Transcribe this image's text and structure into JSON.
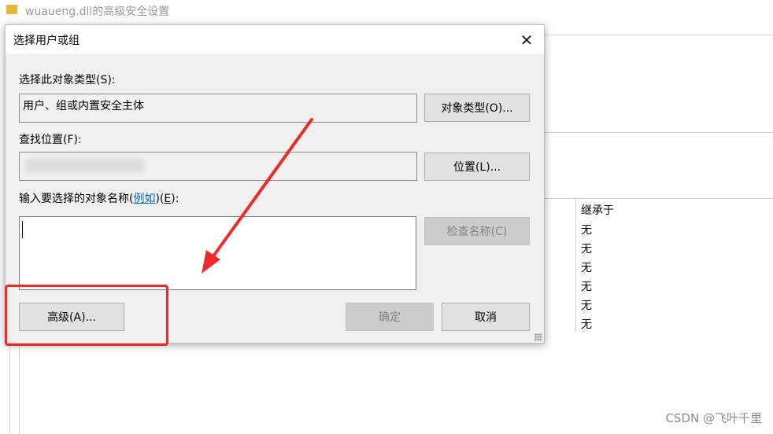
{
  "background_window": {
    "title": "wuaueng.dll的高级安全设置",
    "column_header": "继承于",
    "rows": [
      "无",
      "无",
      "无",
      "无",
      "无",
      "无"
    ]
  },
  "dialog": {
    "title": "选择用户或组",
    "object_type_label": "选择此对象类型(S):",
    "object_type_value": "用户、组或内置安全主体",
    "object_types_button": "对象类型(O)...",
    "location_label": "查找位置(F):",
    "location_button": "位置(L)...",
    "enter_names_label_prefix": "输入要选择的对象名称(",
    "enter_names_link": "例如",
    "enter_names_label_suffix_open": ")(",
    "enter_names_shortcut": "E",
    "enter_names_label_suffix_close": "):",
    "check_names_button": "检查名称(C)",
    "advanced_button": "高级(A)...",
    "ok_button": "确定",
    "cancel_button": "取消"
  },
  "annotation": {
    "highlight_color": "#ee2b2b"
  },
  "watermark": "CSDN @飞叶千里"
}
